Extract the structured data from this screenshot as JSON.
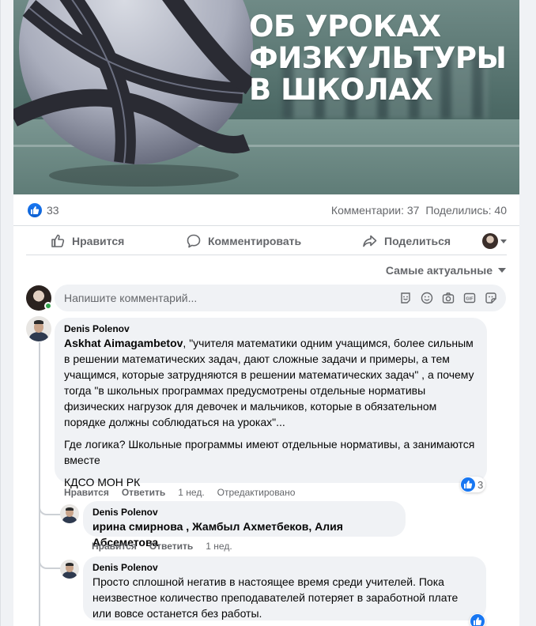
{
  "post": {
    "image_headline": "ОБ УРОКАХ\nФИЗКУЛЬТУРЫ\nВ ШКОЛАХ",
    "reactions_count": "33",
    "comments_label": "Комментарии: 37",
    "shares_label": "Поделились: 40"
  },
  "actions": {
    "like": "Нравится",
    "comment": "Комментировать",
    "share": "Поделиться"
  },
  "sort": {
    "label": "Самые актуальные"
  },
  "composer": {
    "placeholder": "Напишите комментарий..."
  },
  "comments": [
    {
      "author": "Denis Polenov",
      "mention": "Askhat Aimagambetov",
      "text_p1": ", \"учителя математики одним учащимся, более сильным в решении математических задач, дают сложные задачи и примеры, а тем учащимся, которые затрудняются в решении математических задач\" , а почему тогда \"в школьных программах предусмотрены отдельные нормативы физических нагрузок для девочек и мальчиков, которые в обязательном порядке должны соблюдаться на уроках\"...",
      "text_p2": "Где логика? Школьные программы имеют отдельные нормативы, а занимаются вместе",
      "text_p3": "КДСО МОН РК",
      "like": "Нравится",
      "reply": "Ответить",
      "time": "1 нед.",
      "edited": "Отредактировано",
      "reactions": "3"
    },
    {
      "author": "Denis Polenov",
      "text": "ирина смирнова , Жамбыл Ахметбеков, Алия Абсеметова",
      "like": "Нравится",
      "reply": "Ответить",
      "time": "1 нед."
    },
    {
      "author": "Denis Polenov",
      "text": "Просто сплошной негатив в настоящее время среди учителей. Пока неизвестное количество преподавателей потеряет в заработной плате или вовсе останется без работы."
    }
  ],
  "colors": {
    "brand": "#1877f2",
    "bubble": "#f0f2f5",
    "muted": "#65676b"
  }
}
